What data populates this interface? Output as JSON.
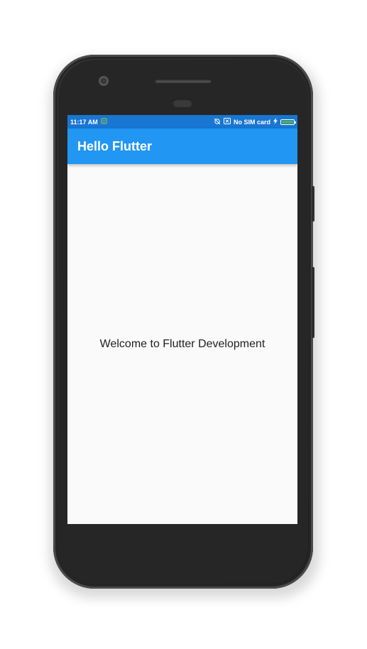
{
  "status_bar": {
    "time": "11:17 AM",
    "notification_icon": "android-robot-icon",
    "sync_icon": "sync-off-icon",
    "sim_icon": "no-sim-icon",
    "carrier": "No SIM card",
    "charging_icon": "charging-bolt-icon",
    "battery_level": 1.0,
    "battery_color": "#4caf50"
  },
  "app_bar": {
    "title": "Hello Flutter",
    "color": "#2196f3"
  },
  "body": {
    "welcome_text": "Welcome to Flutter Development",
    "background": "#fafafa"
  }
}
